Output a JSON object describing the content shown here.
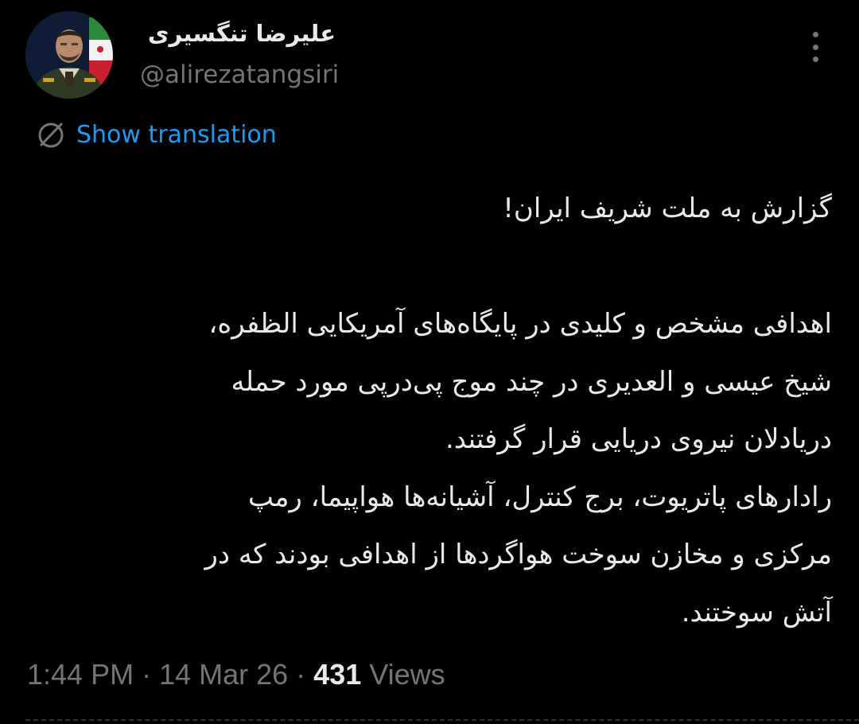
{
  "author": {
    "display_name": "علیرضا تنگسیری",
    "handle": "@alirezatangsiri",
    "avatar_icon": "profile-photo-with-iran-flag"
  },
  "more_icon": "more-vertical-icon",
  "translation": {
    "icon": "translate-globe-icon",
    "label": "Show translation"
  },
  "tweet": {
    "lines": [
      "گزارش به ملت شریف ایران!",
      "",
      "اهدافی مشخص و کلیدی در پایگاه‌های آمریکایی الظفره،",
      "شیخ عیسی و العدیری در چند موج پی‌درپی مورد حمله",
      "دریادلان نیروی دریایی قرار گرفتند.",
      "رادارهای پاتریوت، برج کنترل، آشیانه‌ها هواپیما، رمپ",
      "مرکزی و مخازن سوخت هواگردها از اهدافی بودند که در",
      "آتش سوختند."
    ]
  },
  "meta": {
    "time": "1:44 PM",
    "date": "14 Mar 26",
    "separator": "·",
    "views_count": "431",
    "views_label": "Views"
  },
  "colors": {
    "background": "#000000",
    "text": "#e7e9ea",
    "secondary": "#71767b",
    "accent": "#1d9bf0"
  }
}
